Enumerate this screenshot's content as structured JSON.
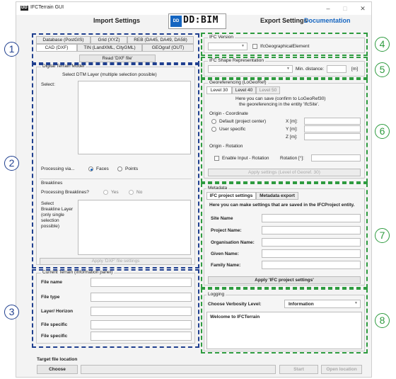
{
  "window": {
    "title": "IFCTerrain GUI",
    "icon_label": "DD",
    "minimize": "–",
    "maximize": "□",
    "close": "✕"
  },
  "header": {
    "import_settings": "Import Settings",
    "export_settings": "Export Settings",
    "documentation": "Documentation",
    "logo_text": "DD:BIM",
    "logo_mark": "DD"
  },
  "import": {
    "tabs_row1": [
      "Database (PostGIS)",
      "Grid (XYZ)",
      "REB (DA45, DA49, DA58)"
    ],
    "tabs_row2": [
      "CAD (DXF)",
      "TIN (LandXML, CityGML)",
      "GEOgraf (OUT)"
    ],
    "read_button": "Read 'DXF file'",
    "dtm_group": "Digital Terrain Model",
    "select_layer_title": "Select DTM Layer (multiple selection possible)",
    "select_label": "Select:",
    "processing_via": "Processing via...",
    "faces": "Faces",
    "points": "Points",
    "breaklines_title": "Breaklines",
    "processing_breaklines": "Processing Breaklines?",
    "yes": "Yes",
    "no": "No",
    "select_breakline_layer": [
      "Select",
      "Breakline Layer",
      "(only single",
      "selection",
      "possible)"
    ],
    "apply_button": "Apply 'DXF' file settings"
  },
  "current_terrain": {
    "group": "Current Terrain (information panel)",
    "fields": [
      "File name",
      "File type",
      "Layer/ Horizon",
      "File specific",
      "File specific"
    ]
  },
  "target": {
    "label": "Target file location",
    "choose": "Choose",
    "start": "Start",
    "open_location": "Open location"
  },
  "export": {
    "ifc_version_group": "IFC Version",
    "ifc_geo_element": "IfcGeographicalElement",
    "ifc_shape_group": "IFC Shape Representation",
    "min_distance": "Min. distance:",
    "min_unit": "[m]",
    "georef_group": "Georeferencing (LoGeoRef)",
    "georef_tabs": [
      "Level 30",
      "Level 40",
      "Level 50"
    ],
    "georef_info": [
      "Here you can save (confirm to LoGeoRef30)",
      "the georeferencing in the entity 'IfcSite'."
    ],
    "origin_coord": "Origin - Coordinate",
    "default_center": "Default (project center)",
    "user_specific": "User specific",
    "x_label": "X [m]:",
    "y_label": "Y [m]:",
    "z_label": "Z [m]:",
    "origin_rotation": "Origin - Rotation",
    "enable_rotation": "Enable Input - Rotation",
    "rotation_label": "Rotation [°]:",
    "apply_georef": "Apply settings (Level of Georef. 30)",
    "metadata_group": "Metadata",
    "metadata_tabs": [
      "IFC project settings",
      "Metadata export"
    ],
    "metadata_info": "Here you can make settings that are saved in the IFCProject entity.",
    "meta_fields": [
      "Site Name",
      "Project Name:",
      "Organisation Name:",
      "Given Name:",
      "Family Name:"
    ],
    "apply_ifc": "Apply 'IFC project settings'",
    "logging_group": "Logging",
    "verbosity_label": "Choose Verbosity Level:",
    "verbosity_value": "Information",
    "log_message": "Welcome to IFCTerrain"
  },
  "callouts": [
    "1",
    "2",
    "3",
    "4",
    "5",
    "6",
    "7",
    "8"
  ],
  "colors": {
    "accent": "#1565c0",
    "blue_dash": "#1f3f8f",
    "green_dash": "#2e9b3f"
  }
}
